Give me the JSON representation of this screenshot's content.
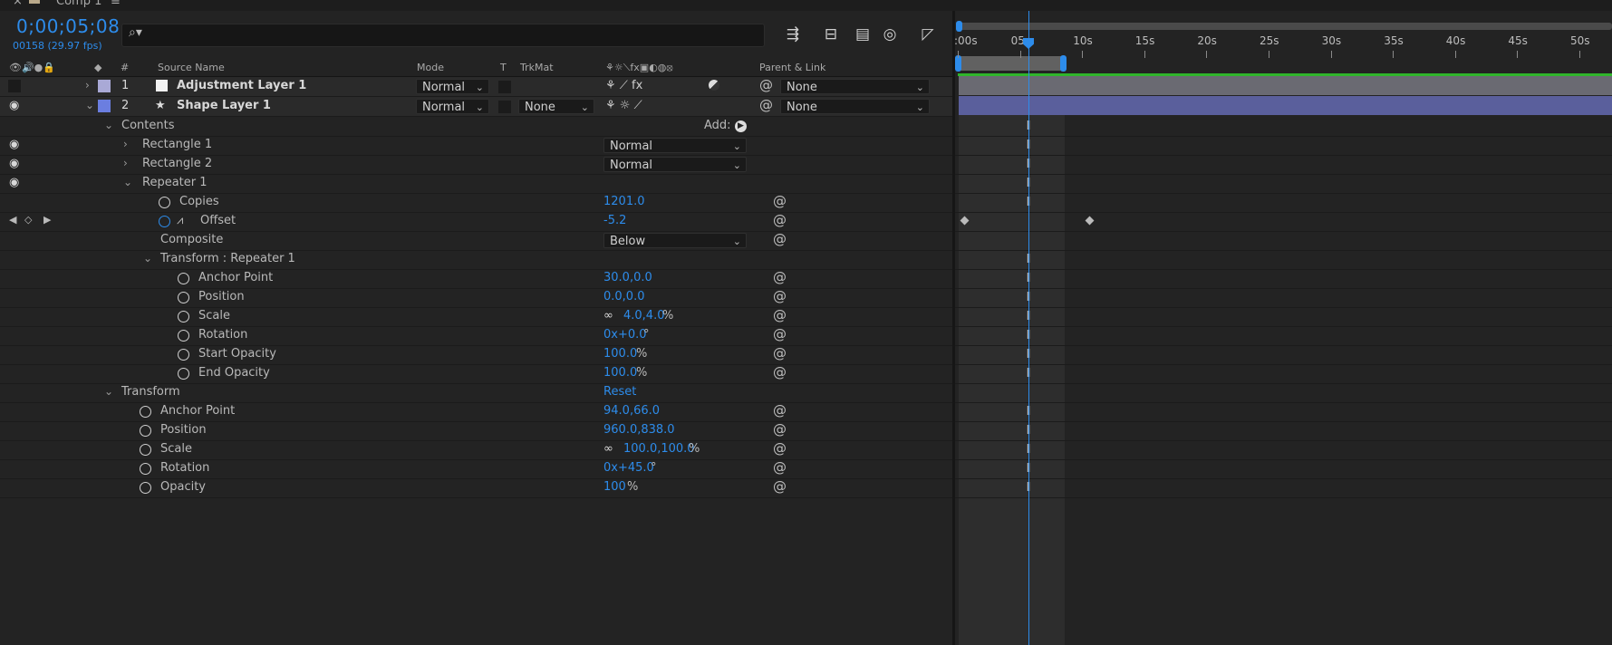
{
  "tab": {
    "close_glyph": "×",
    "title": "Comp 1",
    "menu_glyph": "≡"
  },
  "time": {
    "timecode": "0;00;05;08",
    "frames": "00158 (29.97 fps)"
  },
  "search": {
    "glyph": "⌕▾",
    "value": "",
    "placeholder": ""
  },
  "toolbar_icons": [
    "comp-flowchart-icon",
    "draft-3d-icon",
    "frame-blending-icon",
    "motion-blur-icon",
    "graph-editor-icon"
  ],
  "columns": {
    "source_name": "Source Name",
    "number": "#",
    "mode": "Mode",
    "t": "T",
    "trkmat": "TrkMat",
    "switches": "⚘☼⟍fx▣◐◍⦻",
    "parent": "Parent & Link"
  },
  "layers": [
    {
      "number": "1",
      "name": "Adjustment Layer 1",
      "color": "#a9a9d6",
      "mode": "Normal",
      "trkmat": "",
      "parent": "None",
      "switches": "⚘ ⟋ fx"
    },
    {
      "number": "2",
      "name": "Shape Layer 1",
      "color": "#6b7ee0",
      "mode": "Normal",
      "trkmat": "None",
      "parent": "None",
      "switches": "⚘ ☼ ⟋"
    }
  ],
  "props": {
    "contents": "Contents",
    "add": "Add:",
    "rect1": "Rectangle 1",
    "rect1_mode": "Normal",
    "rect2": "Rectangle 2",
    "rect2_mode": "Normal",
    "repeater": "Repeater 1",
    "copies": "Copies",
    "copies_val": "1201.0",
    "offset": "Offset",
    "offset_val": "-5.2",
    "composite": "Composite",
    "composite_val": "Below",
    "transform_rep": "Transform : Repeater 1",
    "anchor": "Anchor Point",
    "anchor_val": "30.0,0.0",
    "position": "Position",
    "position_val": "0.0,0.0",
    "scale": "Scale",
    "scale_val": "4.0,4.0",
    "pct": "%",
    "rotation": "Rotation",
    "rotation_val": "0x+0.0",
    "deg": "°",
    "start_op": "Start Opacity",
    "start_op_val": "100.0",
    "end_op": "End Opacity",
    "end_op_val": "100.0",
    "transform": "Transform",
    "reset": "Reset",
    "t_anchor": "Anchor Point",
    "t_anchor_val": "94.0,66.0",
    "t_position": "Position",
    "t_position_val": "960.0,838.0",
    "t_scale": "Scale",
    "t_scale_val": "100.0,100.0",
    "t_rotation": "Rotation",
    "t_rotation_val": "0x+45.0",
    "t_opacity": "Opacity",
    "t_opacity_val": "100"
  },
  "ruler": {
    "labels": [
      ":00s",
      "05s",
      "10s",
      "15s",
      "20s",
      "25s",
      "30s",
      "35s",
      "40s",
      "45s",
      "50s"
    ]
  },
  "colors": {
    "accent": "#2d8ceb",
    "green": "#2fb52b",
    "layer1_bar": "#6a6a72",
    "layer2_bar": "#5a5f9c"
  }
}
